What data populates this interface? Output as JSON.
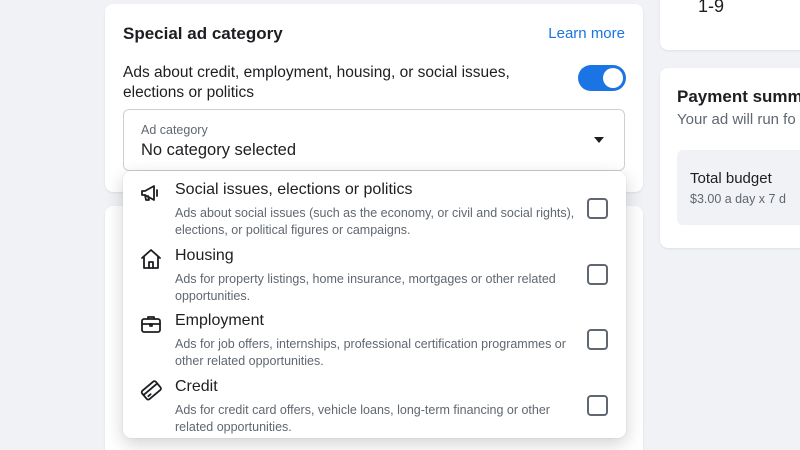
{
  "special_ad_category": {
    "title": "Special ad category",
    "learn_more": "Learn more",
    "toggle_label": "Ads about credit, employment, housing, or social issues, elections or politics",
    "toggle_on": true,
    "select": {
      "label": "Ad category",
      "value": "No category selected"
    }
  },
  "dropdown": {
    "options": [
      {
        "icon": "megaphone-icon",
        "title": "Social issues, elections or politics",
        "description": "Ads about social issues (such as the economy, or civil and social rights), elections, or political figures or campaigns.",
        "checked": false
      },
      {
        "icon": "house-icon",
        "title": "Housing",
        "description": "Ads for property listings, home insurance, mortgages or other related opportunities.",
        "checked": false
      },
      {
        "icon": "briefcase-icon",
        "title": "Employment",
        "description": "Ads for job offers, internships, professional certification programmes or other related opportunities.",
        "checked": false
      },
      {
        "icon": "credit-card-icon",
        "title": "Credit",
        "description": "Ads for credit card offers, vehicle loans, long-term financing or other related opportunities.",
        "checked": false
      }
    ]
  },
  "right_panel": {
    "top_value": "1-9",
    "payment_summary": {
      "title": "Payment summ",
      "subtitle": "Your ad will run fo",
      "budget_title": "Total budget",
      "budget_value": "$3.00 a day x 7 d"
    }
  },
  "colors": {
    "accent": "#1b74e4",
    "background": "#f0f2f5"
  }
}
